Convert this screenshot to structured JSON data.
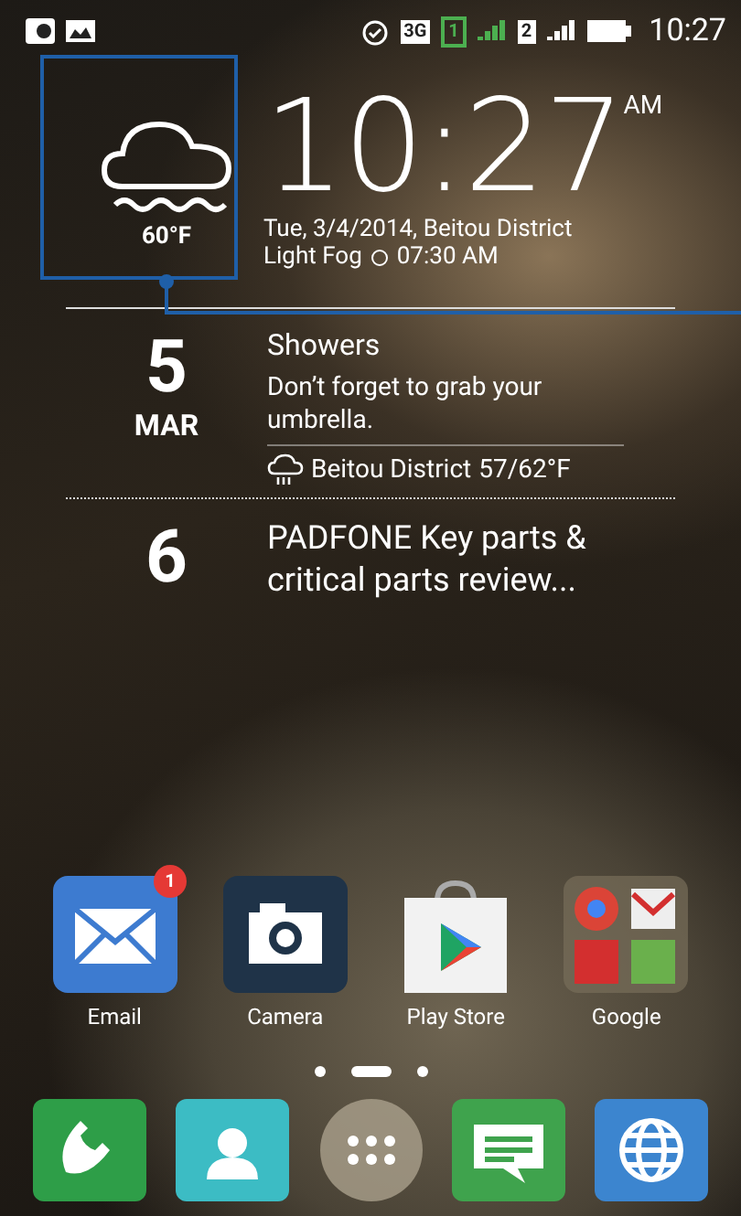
{
  "status_bar": {
    "network": "3G",
    "sim_slots": [
      "1",
      "2"
    ],
    "time": "10:27"
  },
  "weather": {
    "temperature": "60°F"
  },
  "clock": {
    "time": "10:27",
    "period": "AM",
    "date_line": "Tue, 3/4/2014, Beitou District",
    "condition": "Light Fog",
    "alarm": "07:30 AM"
  },
  "agenda": [
    {
      "day": "5",
      "month": "MAR",
      "title": "Showers",
      "note": "Don’t forget to grab your umbrella.",
      "forecast": {
        "place": "Beitou District",
        "temps": "57/62°F"
      }
    },
    {
      "day": "6",
      "title": "PADFONE Key parts & critical parts review..."
    }
  ],
  "apps": [
    {
      "kind": "email",
      "label": "Email",
      "badge": "1"
    },
    {
      "kind": "camera",
      "label": "Camera"
    },
    {
      "kind": "store",
      "label": "Play Store"
    },
    {
      "kind": "folder",
      "label": "Google"
    }
  ],
  "pages": [
    {
      "selected": false
    },
    {
      "selected": true
    },
    {
      "selected": false
    }
  ],
  "dock": [
    {
      "kind": "phone"
    },
    {
      "kind": "contacts"
    },
    {
      "kind": "drawer"
    },
    {
      "kind": "messages"
    },
    {
      "kind": "browser"
    }
  ]
}
